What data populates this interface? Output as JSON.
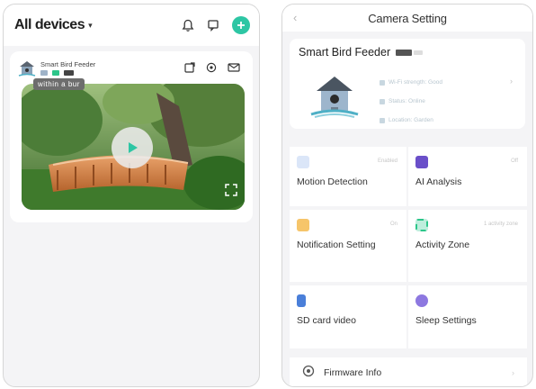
{
  "left": {
    "header": {
      "title": "All devices",
      "caret": "▾"
    },
    "device": {
      "name": "Smart Bird Feeder",
      "tooltip": "within a bur"
    }
  },
  "right": {
    "header": {
      "back": "‹",
      "title": "Camera Setting"
    },
    "device": {
      "name": "Smart Bird Feeder",
      "info": [
        "Wi-Fi strength: Good",
        "Status: Online",
        "Location: Garden"
      ]
    },
    "features": [
      {
        "label": "Motion Detection",
        "badge": "Enabled",
        "icon": "motion-icon",
        "color": "#4a7fd9"
      },
      {
        "label": "AI Analysis",
        "badge": "Off",
        "icon": "ai-analysis-icon",
        "color": "#6a4fc9"
      },
      {
        "label": "Notification Setting",
        "badge": "On",
        "icon": "notification-icon",
        "color": "#f2b53a"
      },
      {
        "label": "Activity Zone",
        "badge": "1 activity zone",
        "icon": "activity-zone-icon",
        "color": "#2dc68a"
      },
      {
        "label": "SD card video",
        "badge": "",
        "icon": "sd-card-icon",
        "color": "#4a7fd9"
      },
      {
        "label": "Sleep Settings",
        "badge": "",
        "icon": "sleep-icon",
        "color": "#6a4fc9"
      }
    ],
    "firmware": {
      "label": "Firmware Info",
      "chevron": "›"
    },
    "chevron": "›"
  },
  "colors": {
    "accent": "#2dc6a4",
    "background": "#f4f4f6"
  }
}
